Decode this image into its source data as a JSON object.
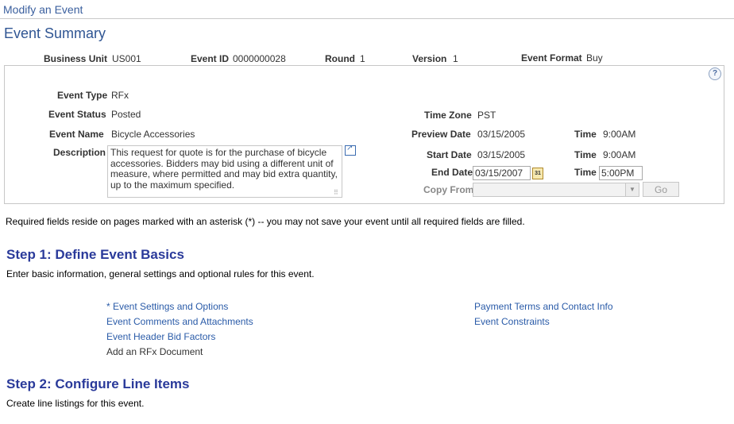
{
  "breadcrumb": "Modify an Event",
  "page_title": "Event Summary",
  "header": {
    "business_unit_label": "Business Unit",
    "business_unit": "US001",
    "event_id_label": "Event ID",
    "event_id": "0000000028",
    "round_label": "Round",
    "round": "1",
    "version_label": "Version",
    "version": "1",
    "event_format_label": "Event Format",
    "event_format": "Buy"
  },
  "details": {
    "event_type_label": "Event Type",
    "event_type": "RFx",
    "event_status_label": "Event Status",
    "event_status": "Posted",
    "event_name_label": "Event Name",
    "event_name": "Bicycle Accessories",
    "description_label": "Description",
    "description": "This request for quote is for the purchase of bicycle accessories.  Bidders may bid using a different unit of measure, where permitted and may bid extra quantity, up to the maximum specified.",
    "time_zone_label": "Time Zone",
    "time_zone": "PST",
    "preview_date_label": "Preview Date",
    "preview_date": "03/15/2005",
    "preview_time_label": "Time",
    "preview_time": "9:00AM",
    "start_date_label": "Start Date",
    "start_date": "03/15/2005",
    "start_time_label": "Time",
    "start_time": "9:00AM",
    "end_date_label": "End Date",
    "end_date": "03/15/2007",
    "end_time_label": "Time",
    "end_time": "5:00PM",
    "copy_from_label": "Copy From",
    "copy_from": "",
    "go_label": "Go",
    "calendar_glyph": "31",
    "help_glyph": "?"
  },
  "required_note": "Required fields reside on pages marked with an asterisk (*) -- you may not save your event until all required fields are filled.",
  "step1": {
    "title": "Step 1: Define Event Basics",
    "desc": "Enter basic information, general settings and optional rules for this event.",
    "links": {
      "settings": "* Event Settings and Options",
      "comments": "Event Comments and Attachments",
      "bid_factors": "Event Header Bid Factors",
      "rfx_document": "Add an RFx Document",
      "payment_terms": "Payment Terms and Contact Info",
      "constraints": "Event Constraints"
    }
  },
  "step2": {
    "title": "Step 2: Configure Line Items",
    "desc": "Create line listings for this event."
  }
}
